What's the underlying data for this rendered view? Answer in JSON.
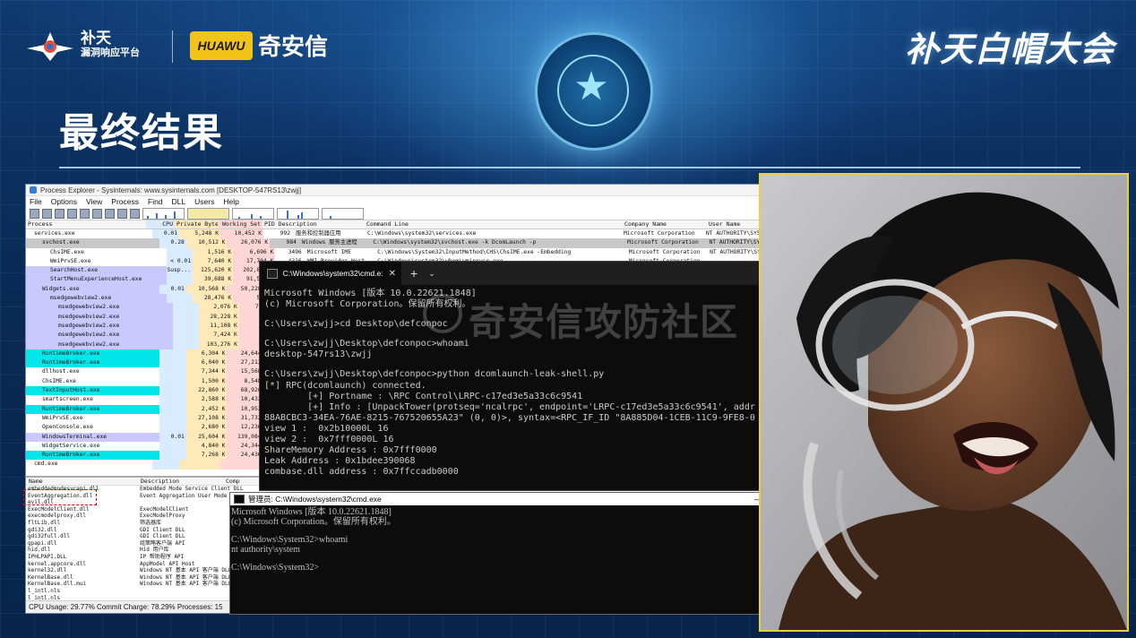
{
  "slide": {
    "title": "最终结果",
    "event_title": "补天白帽大会",
    "logo_left": {
      "name": "补天",
      "subtitle": "漏洞响应平台"
    },
    "logo_right": {
      "mark": "HUAWU",
      "name": "奇安信"
    },
    "colors": {
      "background": "#0b2a52",
      "photo_border": "#e8d23a",
      "title_line": "#bee1ff"
    }
  },
  "process_explorer": {
    "window_title": "Process Explorer - Sysinternals: www.sysinternals.com [DESKTOP-547RS13\\zwjj]",
    "menu": [
      "File",
      "Options",
      "View",
      "Process",
      "Find",
      "DLL",
      "Users",
      "Help"
    ],
    "columns": [
      "Process",
      "CPU",
      "Private Bytes",
      "Working Set",
      "PID Description",
      "Command Line",
      "Company Name",
      "User Name"
    ],
    "rows": [
      {
        "indent": 1,
        "name": "services.exe",
        "cpu": "0.01",
        "priv": "5,248 K",
        "ws": "10,452 K",
        "pid": "992",
        "desc": "服务和控制器应用",
        "cmd": "C:\\Windows\\system32\\services.exe",
        "company": "Microsoft Corporation",
        "user": "NT AUTHORITY\\SYS",
        "hl": ""
      },
      {
        "indent": 2,
        "name": "svchost.exe",
        "cpu": "0.28",
        "priv": "10,512 K",
        "ws": "26,076 K",
        "pid": "984",
        "desc": "Windows 服务主进程",
        "cmd": "C:\\Windows\\system32\\svchost.exe -k DcomLaunch -p",
        "company": "Microsoft Corporation",
        "user": "NT AUTHORITY\\SYS",
        "hl": "hl-sel"
      },
      {
        "indent": 3,
        "name": "ChsIME.exe",
        "cpu": "",
        "priv": "1,516 K",
        "ws": "6,696 K",
        "pid": "3496",
        "desc": "Microsoft IME",
        "cmd": "C:\\Windows\\System32\\InputMethod\\CHS\\ChsIME.exe -Embedding",
        "company": "Microsoft Corporation",
        "user": "NT AUTHORITY\\SYS",
        "hl": ""
      },
      {
        "indent": 3,
        "name": "WmiPrvSE.exe",
        "cpu": "< 0.01",
        "priv": "7,640 K",
        "ws": "17,704 K",
        "pid": "4316",
        "desc": "WMI Provider Host",
        "cmd": "C:\\Windows\\system32\\wbem\\wmiprvse.exe",
        "company": "Microsoft Corporation",
        "user": "",
        "hl": ""
      },
      {
        "indent": 3,
        "name": "SearchHost.exe",
        "cpu": "Susp...",
        "priv": "125,620 K",
        "ws": "202,844 K",
        "pid": "",
        "desc": "",
        "cmd": "",
        "company": "",
        "user": "",
        "hl": "hl-violet"
      },
      {
        "indent": 3,
        "name": "StartMenuExperienceHost.exe",
        "cpu": "",
        "priv": "39,688 K",
        "ws": "91,572 K",
        "pid": "",
        "desc": "",
        "cmd": "",
        "company": "",
        "user": "",
        "hl": "hl-violet"
      },
      {
        "indent": 2,
        "name": "Widgets.exe",
        "cpu": "0.01",
        "priv": "10,568 K",
        "ws": "50,228 K",
        "pid": "",
        "desc": "",
        "cmd": "",
        "company": "",
        "user": "",
        "hl": "hl-violet"
      },
      {
        "indent": 3,
        "name": "msedgewebview2.exe",
        "cpu": "",
        "priv": "28,476 K",
        "ws": "540 K",
        "pid": "",
        "desc": "",
        "cmd": "",
        "company": "",
        "user": "",
        "hl": "hl-violet"
      },
      {
        "indent": 4,
        "name": "msedgewebview2.exe",
        "cpu": "",
        "priv": "2,076 K",
        "ws": "7,968 K",
        "pid": "",
        "desc": "",
        "cmd": "",
        "company": "",
        "user": "",
        "hl": "hl-violet"
      },
      {
        "indent": 4,
        "name": "msedgewebview2.exe",
        "cpu": "",
        "priv": "28,228 K",
        "ws": "196 K",
        "pid": "",
        "desc": "",
        "cmd": "",
        "company": "",
        "user": "",
        "hl": "hl-violet"
      },
      {
        "indent": 4,
        "name": "msedgewebview2.exe",
        "cpu": "",
        "priv": "11,108 K",
        "ws": "0 K",
        "pid": "",
        "desc": "",
        "cmd": "",
        "company": "",
        "user": "",
        "hl": "hl-violet"
      },
      {
        "indent": 4,
        "name": "msedgewebview2.exe",
        "cpu": "",
        "priv": "7,424 K",
        "ws": "0 K",
        "pid": "",
        "desc": "",
        "cmd": "",
        "company": "",
        "user": "",
        "hl": "hl-violet"
      },
      {
        "indent": 4,
        "name": "msedgewebview2.exe",
        "cpu": "",
        "priv": "103,276 K",
        "ws": "584 K",
        "pid": "",
        "desc": "",
        "cmd": "",
        "company": "",
        "user": "",
        "hl": "hl-violet"
      },
      {
        "indent": 2,
        "name": "RuntimeBroker.exe",
        "cpu": "",
        "priv": "6,304 K",
        "ws": "24,644 K",
        "pid": "",
        "desc": "",
        "cmd": "",
        "company": "",
        "user": "",
        "hl": "hl-cyan"
      },
      {
        "indent": 2,
        "name": "RuntimeBroker.exe",
        "cpu": "",
        "priv": "6,040 K",
        "ws": "27,212 K",
        "pid": "",
        "desc": "",
        "cmd": "",
        "company": "",
        "user": "",
        "hl": "hl-cyan"
      },
      {
        "indent": 2,
        "name": "dllhost.exe",
        "cpu": "",
        "priv": "7,344 K",
        "ws": "15,568 K",
        "pid": "",
        "desc": "",
        "cmd": "",
        "company": "",
        "user": "",
        "hl": ""
      },
      {
        "indent": 2,
        "name": "ChsIME.exe",
        "cpu": "",
        "priv": "1,500 K",
        "ws": "8,548 K",
        "pid": "",
        "desc": "",
        "cmd": "",
        "company": "",
        "user": "",
        "hl": ""
      },
      {
        "indent": 2,
        "name": "TextInputHost.exe",
        "cpu": "",
        "priv": "22,860 K",
        "ws": "68,928 K",
        "pid": "",
        "desc": "",
        "cmd": "",
        "company": "",
        "user": "",
        "hl": "hl-cyan"
      },
      {
        "indent": 2,
        "name": "smartscreen.exe",
        "cpu": "",
        "priv": "2,588 K",
        "ws": "10,432 K",
        "pid": "",
        "desc": "",
        "cmd": "",
        "company": "",
        "user": "",
        "hl": ""
      },
      {
        "indent": 2,
        "name": "RuntimeBroker.exe",
        "cpu": "",
        "priv": "2,452 K",
        "ws": "10,952 K",
        "pid": "",
        "desc": "",
        "cmd": "",
        "company": "",
        "user": "",
        "hl": "hl-cyan"
      },
      {
        "indent": 2,
        "name": "WmiPrvSE.exe",
        "cpu": "",
        "priv": "27,108 K",
        "ws": "31,732 K",
        "pid": "",
        "desc": "",
        "cmd": "",
        "company": "",
        "user": "",
        "hl": ""
      },
      {
        "indent": 2,
        "name": "OpenConsole.exe",
        "cpu": "",
        "priv": "2,680 K",
        "ws": "12,236 K",
        "pid": "",
        "desc": "",
        "cmd": "",
        "company": "",
        "user": "",
        "hl": ""
      },
      {
        "indent": 2,
        "name": "WindowsTerminal.exe",
        "cpu": "0.01",
        "priv": "25,604 K",
        "ws": "139,084 K",
        "pid": "",
        "desc": "",
        "cmd": "",
        "company": "",
        "user": "",
        "hl": "hl-violet"
      },
      {
        "indent": 2,
        "name": "WidgetService.exe",
        "cpu": "",
        "priv": "4,840 K",
        "ws": "24,344 K",
        "pid": "",
        "desc": "",
        "cmd": "",
        "company": "",
        "user": "",
        "hl": ""
      },
      {
        "indent": 2,
        "name": "RuntimeBroker.exe",
        "cpu": "",
        "priv": "7,268 K",
        "ws": "24,436 K",
        "pid": "",
        "desc": "",
        "cmd": "",
        "company": "",
        "user": "",
        "hl": "hl-cyan"
      },
      {
        "indent": 1,
        "name": "cmd.exe",
        "cpu": "",
        "priv": "",
        "ws": "",
        "pid": "",
        "desc": "",
        "cmd": "",
        "company": "",
        "user": "",
        "hl": ""
      }
    ],
    "dll_columns": [
      "Name",
      "Description",
      "Comp"
    ],
    "dlls": [
      {
        "name": "embeddedmodesvcapi.dll",
        "desc": "Embedded Mode Service Client DLL"
      },
      {
        "name": "EventAggregation.dll",
        "desc": "Event Aggregation User Mode Li"
      },
      {
        "name": "evil.dll",
        "desc": ""
      },
      {
        "name": "ExecModelClient.dll",
        "desc": "ExecModelClient"
      },
      {
        "name": "execmodelproxy.dll",
        "desc": "ExecModelProxy"
      },
      {
        "name": "fltLib.dll",
        "desc": "筛选器库"
      },
      {
        "name": "gdi32.dll",
        "desc": "GDI Client DLL"
      },
      {
        "name": "gdi32full.dll",
        "desc": "GDI Client DLL"
      },
      {
        "name": "gpapi.dll",
        "desc": "组策略客户端 API"
      },
      {
        "name": "hid.dll",
        "desc": "Hid 用户库"
      },
      {
        "name": "IPHLPAPI.DLL",
        "desc": "IP 帮助程序 API"
      },
      {
        "name": "kernel.appcore.dll",
        "desc": "AppModel API Host"
      },
      {
        "name": "kernel32.dll",
        "desc": "Windows NT 基本 API 客户端 DLL"
      },
      {
        "name": "KernelBase.dll",
        "desc": "Windows NT 基本 API 客户端 DLL"
      },
      {
        "name": "KernelBase.dll.mui",
        "desc": "Windows NT 基本 API 客户端 DLL"
      },
      {
        "name": "l_intl.nls",
        "desc": ""
      },
      {
        "name": "l_intl.nls",
        "desc": ""
      }
    ],
    "status": "CPU Usage: 29.77%    Commit Charge: 78.29%  Processes: 15"
  },
  "cmd1": {
    "tab_title": "C:\\Windows\\system32\\cmd.e:",
    "lines": [
      "Microsoft Windows [版本 10.0.22621.1848]",
      "(c) Microsoft Corporation。保留所有权利。",
      "",
      "C:\\Users\\zwjj>cd Desktop\\defconpoc",
      "",
      "C:\\Users\\zwjj\\Desktop\\defconpoc>whoami",
      "desktop-547rs13\\zwjj",
      "",
      "C:\\Users\\zwjj\\Desktop\\defconpoc>python dcomlaunch-leak-shell.py",
      "[*] RPC(dcomlaunch) connected.",
      "        [+] Portname : \\RPC Control\\LRPC-c17ed3e5a33c6c9541",
      "        [+] Info : [UnpackTower(protseq='ncalrpc', endpoint='LRPC-c17ed3e5a33c6c9541', addr",
      "88ABCBC3-34EA-76AE-8215-767520655A23\" (0, 0)>, syntax=<RPC_IF_ID \"8A885D04-1CEB-11C9-9FE8-0",
      "view 1 :  0x2b10000L 16",
      "view 2 :  0x7fff0000L 16",
      "ShareMemory Address : 0x7fff0000",
      "Leak Address : 0x1bdee390068",
      "combase.dll address : 0x7ffccadb0000"
    ]
  },
  "watermark": "奇安信攻防社区",
  "cmd2": {
    "title": "管理员: C:\\Windows\\system32\\cmd.exe",
    "lines": [
      "Microsoft Windows [版本 10.0.22621.1848]",
      "(c) Microsoft Corporation。保留所有权利。",
      "",
      "C:\\Windows\\System32>whoami",
      "nt authority\\system",
      "",
      "C:\\Windows\\System32>"
    ]
  }
}
